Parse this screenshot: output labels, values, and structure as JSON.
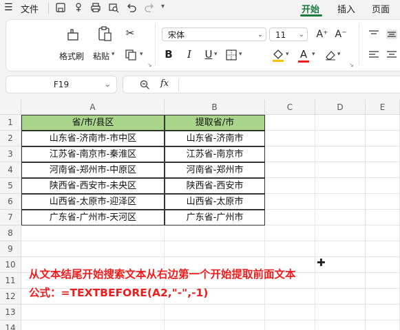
{
  "menu": {
    "file_label": "文件",
    "tabs": [
      {
        "label": "开始",
        "active": true
      },
      {
        "label": "插入",
        "active": false
      },
      {
        "label": "页面",
        "active": false
      }
    ]
  },
  "ribbon": {
    "format_painter_label": "格式刷",
    "paste_label": "粘贴",
    "font_name": "宋体",
    "font_size": "11",
    "bold": "B",
    "italic": "I",
    "underline": "U",
    "font_color_letter": "A",
    "increase_font": "A⁺",
    "decrease_font": "A⁻"
  },
  "formula_bar": {
    "name_box": "F19",
    "fx": "fx",
    "content": ""
  },
  "sheet": {
    "columns": [
      "A",
      "B",
      "C",
      "D",
      "E"
    ],
    "rows": [
      "1",
      "2",
      "3",
      "4",
      "5",
      "6",
      "7",
      "8",
      "9",
      "10",
      "11",
      "12",
      "13",
      "14"
    ],
    "header": [
      "省/市/县区",
      "提取省/市"
    ],
    "data": [
      [
        "山东省-济南市-市中区",
        "山东省-济南市"
      ],
      [
        "江苏省-南京市-秦淮区",
        "江苏省-南京市"
      ],
      [
        "河南省-郑州市-中原区",
        "河南省-郑州市"
      ],
      [
        "陕西省-西安市-未央区",
        "陕西省-西安市"
      ],
      [
        "山西省-太原市-迎泽区",
        "山西省-太原市"
      ],
      [
        "广东省-广州市-天河区",
        "广东省-广州市"
      ]
    ]
  },
  "annotation": {
    "line1": "从文本结尾开始搜索文本从右边第一个开始提取前面文本",
    "line2": "公式：=TEXTBEFORE(A2,\"-\",-1)"
  },
  "colors": {
    "header_fill": "#a8d58a",
    "annotation": "#ee1c1c",
    "active_tab": "#1a7a3c"
  }
}
